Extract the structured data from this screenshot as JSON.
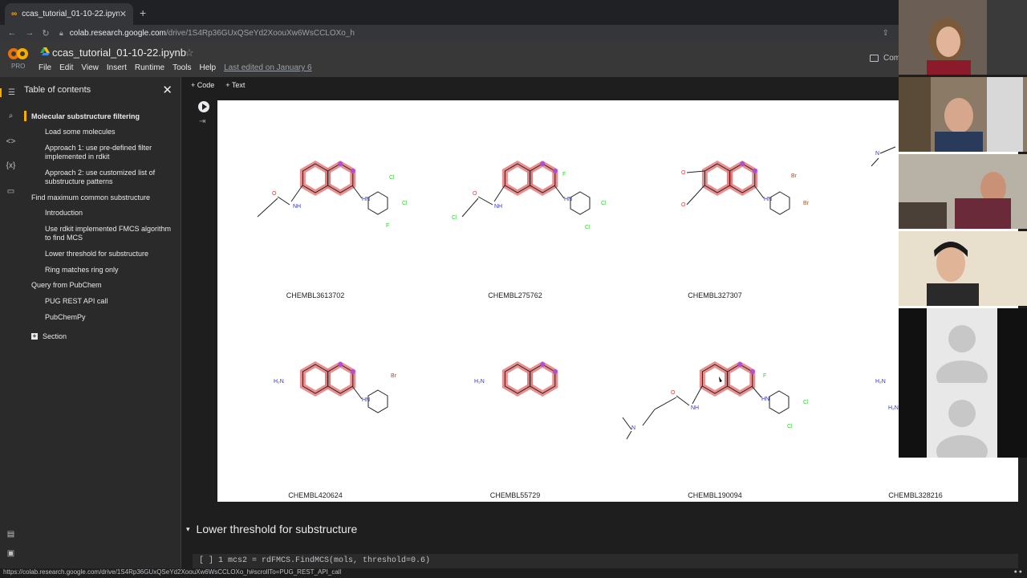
{
  "browser": {
    "tab_title": "ccas_tutorial_01-10-22.ipynb",
    "tab_close": "✕",
    "new_tab": "+",
    "url_host": "colab.research.google.com",
    "url_path": "/drive/1S4Rp36GUxQSeYd2XoouXw6WsCCLOXo_h"
  },
  "colab": {
    "pro_label": "PRO",
    "notebook_title": "ccas_tutorial_01-10-22.ipynb",
    "menu": [
      "File",
      "Edit",
      "View",
      "Insert",
      "Runtime",
      "Tools",
      "Help"
    ],
    "last_edited": "Last edited on January 6",
    "comments_label": "Com"
  },
  "toc": {
    "title": "Table of contents",
    "items": [
      {
        "label": "Molecular substructure filtering",
        "level": 1,
        "current": true
      },
      {
        "label": "Load some molecules",
        "level": 2
      },
      {
        "label": "Approach 1: use pre-defined filter implemented in rdkit",
        "level": 2
      },
      {
        "label": "Approach 2: use customized list of substructure patterns",
        "level": 2
      },
      {
        "label": "Find maximum common substructure",
        "level": 1
      },
      {
        "label": "Introduction",
        "level": 2
      },
      {
        "label": "Use rdkit implemented FMCS algorithm to find MCS",
        "level": 2
      },
      {
        "label": "Lower threshold for substructure",
        "level": 2
      },
      {
        "label": "Ring matches ring only",
        "level": 2
      },
      {
        "label": "Query from PubChem",
        "level": 1
      },
      {
        "label": "PUG REST API call",
        "level": 2
      },
      {
        "label": "PubChemPy",
        "level": 2
      }
    ],
    "section_button": "Section"
  },
  "toolbar": {
    "code_label": "+ Code",
    "text_label": "+ Text"
  },
  "molecules": [
    {
      "id": "CHEMBL3613702"
    },
    {
      "id": "CHEMBL275762"
    },
    {
      "id": "CHEMBL327307"
    },
    {
      "id": "CHEMBL420624"
    },
    {
      "id": "CHEMBL55729"
    },
    {
      "id": "CHEMBL190094"
    },
    {
      "id": "CHEMBL328216"
    }
  ],
  "section_heading": "Lower threshold for substructure",
  "code_line": "[ ]  1  mcs2 = rdFMCS.FindMCS(mols, threshold=0.6)",
  "status_url": "https://colab.research.google.com/drive/1S4Rp36GUxQSeYd2XoouXw6WsCCLOXo_h#scrollTo=PUG_REST_API_call",
  "colors": {
    "accent": "#f9ab00",
    "highlight": "#e57373",
    "nitrogen": "#3333cc",
    "chlorine": "#33cc33",
    "oxygen": "#e53935",
    "bromine": "#a0522d"
  }
}
